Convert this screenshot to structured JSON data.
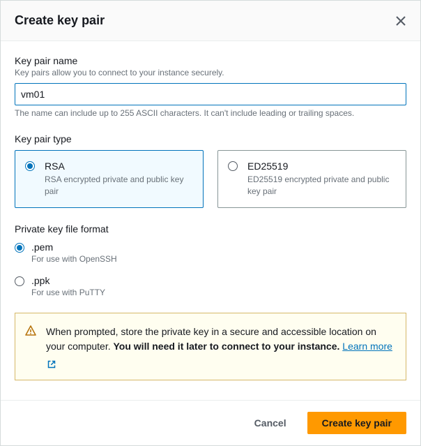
{
  "header": {
    "title": "Create key pair"
  },
  "name": {
    "label": "Key pair name",
    "sublabel": "Key pairs allow you to connect to your instance securely.",
    "value": "vm01",
    "hint": "The name can include up to 255 ASCII characters. It can't include leading or trailing spaces."
  },
  "type": {
    "label": "Key pair type",
    "options": {
      "rsa": {
        "title": "RSA",
        "desc": "RSA encrypted private and public key pair"
      },
      "ed25519": {
        "title": "ED25519",
        "desc": "ED25519 encrypted private and public key pair"
      }
    }
  },
  "format": {
    "label": "Private key file format",
    "options": {
      "pem": {
        "title": ".pem",
        "desc": "For use with OpenSSH"
      },
      "ppk": {
        "title": ".ppk",
        "desc": "For use with PuTTY"
      }
    }
  },
  "alert": {
    "prefix": "When prompted, store the private key in a secure and accessible location on your computer. ",
    "bold": "You will need it later to connect to your instance.",
    "link": "Learn more"
  },
  "footer": {
    "cancel": "Cancel",
    "create": "Create key pair"
  }
}
